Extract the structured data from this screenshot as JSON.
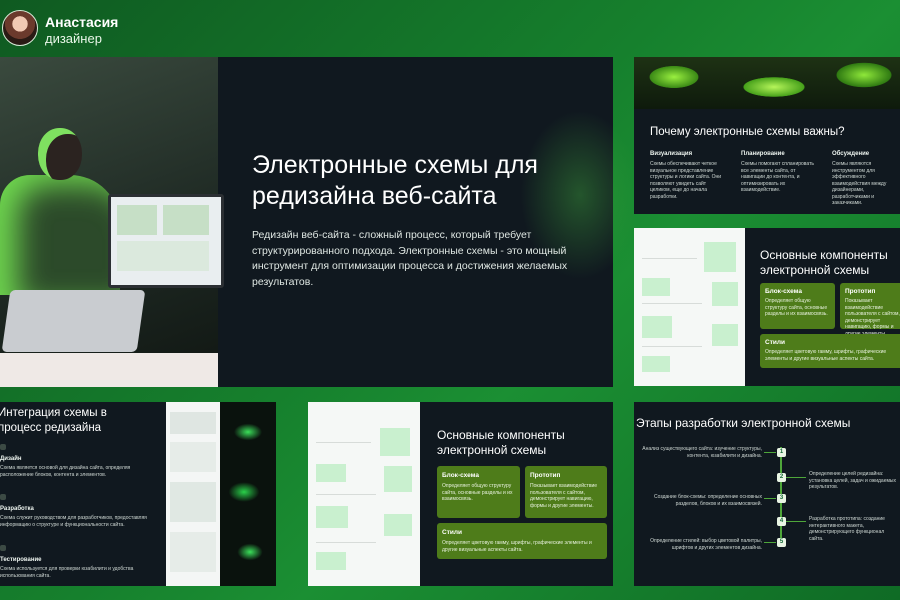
{
  "header": {
    "name": "Анастасия",
    "role": "дизайнер"
  },
  "hero": {
    "title": "Электронные схемы для редизайна веб-сайта",
    "text": "Редизайн веб-сайта - сложный процесс, который требует структурированного подхода. Электронные схемы - это мощный инструмент для оптимизации процесса и достижения желаемых результатов."
  },
  "why": {
    "title": "Почему электронные схемы важны?",
    "columns": [
      {
        "heading": "Визуализация",
        "text": "Схемы обеспечивают четкое визуальное представление структуры и логики сайта. Они позволяют увидеть сайт целиком, еще до начала разработки."
      },
      {
        "heading": "Планирование",
        "text": "Схемы помогают спланировать все элементы сайта, от навигации до контента, и оптимизировать их взаимодействие."
      },
      {
        "heading": "Обсуждение",
        "text": "Схемы являются инструментом для эффективного взаимодействия между дизайнерами, разработчиками и заказчиками."
      }
    ]
  },
  "components_right": {
    "title": "Основные компоненты электронной схемы",
    "cards": [
      {
        "heading": "Блок-схема",
        "text": "Определяет общую структуру сайта, основные разделы и их взаимосвязь."
      },
      {
        "heading": "Прототип",
        "text": "Показывает взаимодействие пользователя с сайтом, демонстрирует навигацию, формы и другие элементы."
      },
      {
        "heading": "Стили",
        "text": "Определяет цветовую гамму, шрифты, графические элементы и другие визуальные аспекты сайта."
      }
    ]
  },
  "integration": {
    "title": "Интеграция схемы в процесс редизайна",
    "items": [
      {
        "heading": "Дизайн",
        "text": "Схема является основой для дизайна сайта, определяя расположение блоков, контента и элементов."
      },
      {
        "heading": "Разработка",
        "text": "Схема служит руководством для разработчиков, предоставляя информацию о структуре и функциональности сайта."
      },
      {
        "heading": "Тестирование",
        "text": "Схема используется для проверки юзабилити и удобства использования сайта."
      }
    ]
  },
  "components_mid": {
    "title": "Основные компоненты электронной схемы",
    "cards": [
      {
        "heading": "Блок-схема",
        "text": "Определяет общую структуру сайта, основные разделы и их взаимосвязь."
      },
      {
        "heading": "Прототип",
        "text": "Показывает взаимодействие пользователя с сайтом, демонстрирует навигацию, формы и другие элементы."
      },
      {
        "heading": "Стили",
        "text": "Определяет цветовую гамму, шрифты, графические элементы и другие визуальные аспекты сайта."
      }
    ]
  },
  "stages": {
    "title": "Этапы разработки электронной схемы",
    "left": [
      "Анализ существующего сайта: изучение структуры, контента, юзабилити и дизайна.",
      "Создание блок-схемы: определение основных разделов, блоков и их взаимосвязей.",
      "Определение стилей: выбор цветовой палитры, шрифтов и других элементов дизайна."
    ],
    "right": [
      "Определение целей редизайна: установка целей, задач и ожидаемых результатов.",
      "Разработка прототипа: создание интерактивного макета, демонстрирующего функционал сайта."
    ],
    "numbers": [
      "1",
      "2",
      "3",
      "4",
      "5"
    ]
  },
  "colors": {
    "accent": "#1b8f33",
    "card": "#4e7c1a",
    "dark": "#10181f"
  }
}
